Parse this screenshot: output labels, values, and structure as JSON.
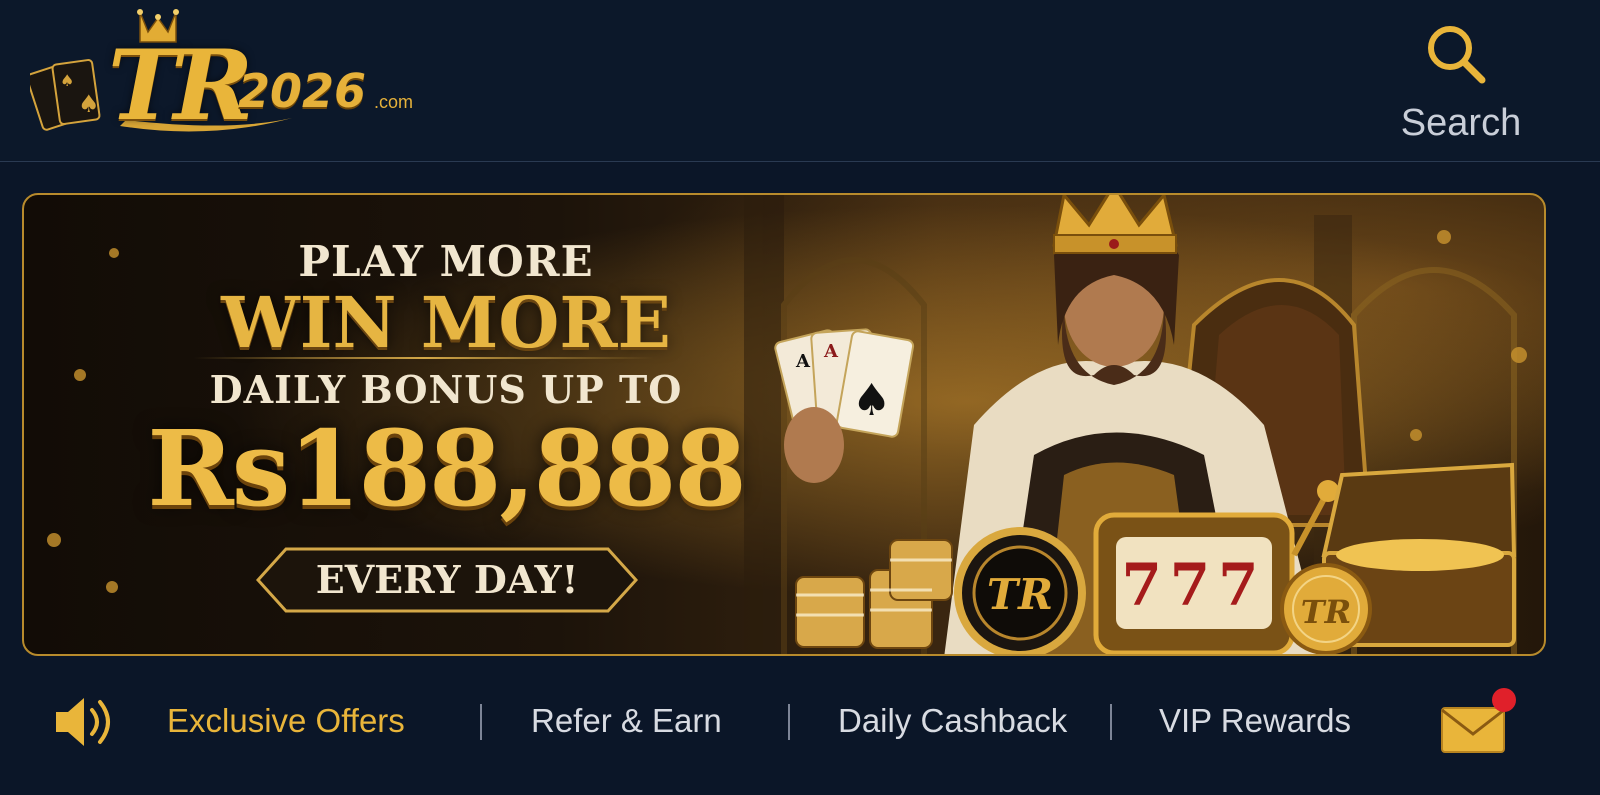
{
  "header": {
    "logo": {
      "mark": "TR",
      "year": "2026",
      "domain": ".com"
    },
    "search": {
      "label": "Search",
      "icon": "search-icon"
    }
  },
  "banner": {
    "line1": "PLAY MORE",
    "line2": "WIN MORE",
    "line3": "DAILY BONUS UP TO",
    "amount": "Rs188,888",
    "cta": "EVERY DAY!",
    "chip_mark": "TR",
    "slot_digits": "777"
  },
  "nav": {
    "speaker_icon": "speaker-icon",
    "items": [
      {
        "label": "Exclusive Offers",
        "active": true
      },
      {
        "label": "Refer & Earn",
        "active": false
      },
      {
        "label": "Daily Cashback",
        "active": false
      },
      {
        "label": "VIP Rewards",
        "active": false
      }
    ],
    "mail_icon": "mail-icon",
    "mail_has_notification": true
  },
  "colors": {
    "background": "#0b1628",
    "gold": "#e9b53a",
    "text": "#d8dbe2",
    "notification": "#e0202a"
  }
}
